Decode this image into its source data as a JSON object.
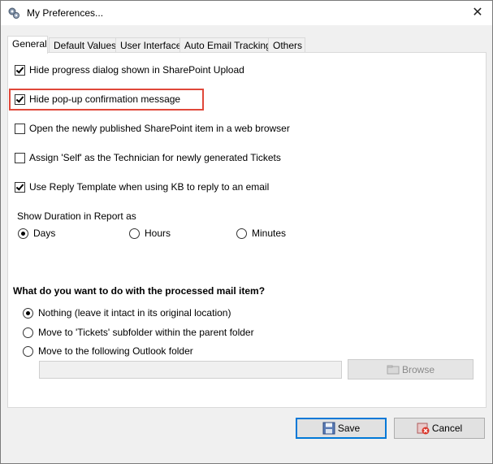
{
  "window": {
    "title": "My Preferences...",
    "close_glyph": "✕"
  },
  "tabs": [
    {
      "label": "General",
      "active": true
    },
    {
      "label": "Default Values",
      "active": false
    },
    {
      "label": "User Interface",
      "active": false
    },
    {
      "label": "Auto Email Tracking",
      "active": false
    },
    {
      "label": "Others",
      "active": false
    }
  ],
  "general": {
    "options": [
      {
        "label": "Hide progress dialog shown in SharePoint Upload",
        "checked": true
      },
      {
        "label": "Hide pop-up confirmation message",
        "checked": true,
        "highlighted": true
      },
      {
        "label": "Open the newly published SharePoint item in a web browser",
        "checked": false
      },
      {
        "label": "Assign 'Self' as the Technician for newly generated Tickets",
        "checked": false
      },
      {
        "label": "Use Reply Template when using KB to reply to an email",
        "checked": true
      }
    ],
    "duration": {
      "label": "Show Duration in Report as",
      "options": [
        {
          "label": "Days",
          "selected": true
        },
        {
          "label": "Hours",
          "selected": false
        },
        {
          "label": "Minutes",
          "selected": false
        }
      ]
    },
    "mail_action": {
      "heading": "What do you want to do with the processed mail item?",
      "options": [
        {
          "label": "Nothing (leave it intact in its original location)",
          "selected": true
        },
        {
          "label": "Move to 'Tickets' subfolder within the parent folder",
          "selected": false
        },
        {
          "label": "Move to the following Outlook folder",
          "selected": false
        }
      ],
      "folder_value": "",
      "browse_label": "Browse"
    }
  },
  "footer": {
    "save_label": "Save",
    "cancel_label": "Cancel"
  },
  "colors": {
    "highlight_border": "#e0483a",
    "primary_button_border": "#0078d7"
  }
}
